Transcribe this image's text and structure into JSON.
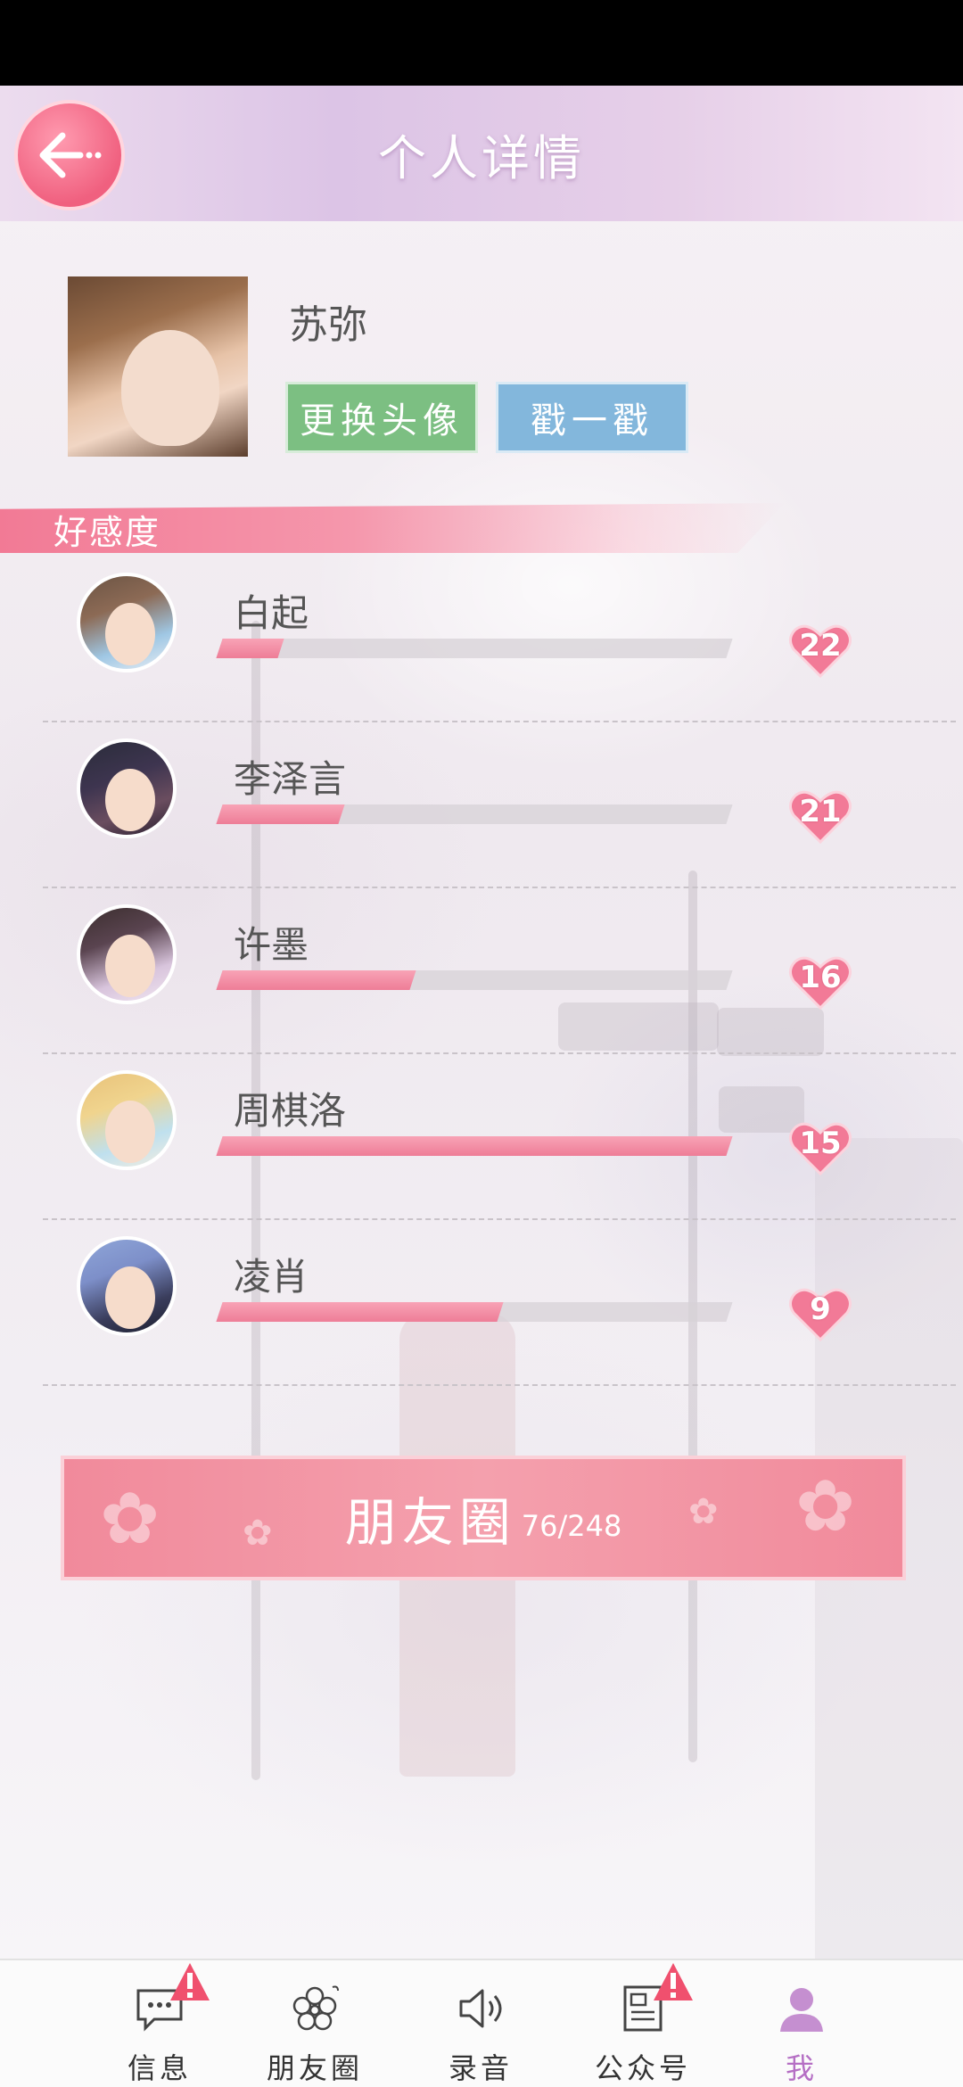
{
  "header": {
    "title": "个人详情",
    "back_icon": "back-arrow-icon"
  },
  "profile": {
    "name": "苏弥",
    "change_avatar_label": "更换头像",
    "poke_label": "戳一戳"
  },
  "affection": {
    "section_title": "好感度",
    "characters": [
      {
        "name": "白起",
        "level": "22",
        "progress": 0.12
      },
      {
        "name": "李泽言",
        "level": "21",
        "progress": 0.24
      },
      {
        "name": "许墨",
        "level": "16",
        "progress": 0.38
      },
      {
        "name": "周棋洛",
        "level": "15",
        "progress": 1.0
      },
      {
        "name": "凌肖",
        "level": "9",
        "progress": 0.55
      }
    ]
  },
  "moments": {
    "label": "朋友圈",
    "count": "76/248"
  },
  "tabbar": {
    "items": [
      {
        "label": "信息",
        "icon": "message-icon",
        "badge": true
      },
      {
        "label": "朋友圈",
        "icon": "flower-icon",
        "badge": false
      },
      {
        "label": "录音",
        "icon": "speaker-icon",
        "badge": false
      },
      {
        "label": "公众号",
        "icon": "news-icon",
        "badge": true
      },
      {
        "label": "我",
        "icon": "profile-icon",
        "badge": false,
        "active": true
      }
    ]
  },
  "colors": {
    "accent_pink": "#f0607f",
    "progress_pink": "#ee7d97",
    "button_green": "#7cbf82",
    "button_blue": "#83b7dc",
    "active_tab": "#c58fd0"
  }
}
